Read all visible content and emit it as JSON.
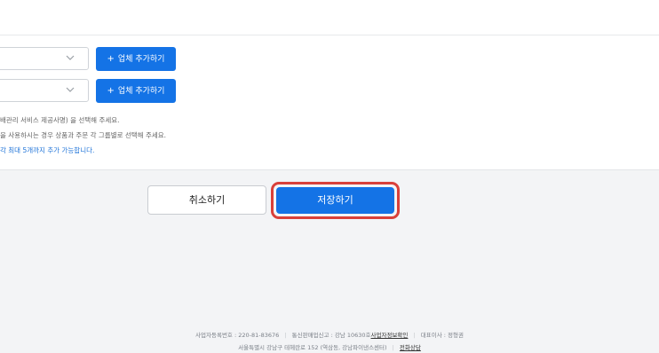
{
  "form": {
    "rows": [
      {
        "select_value": "",
        "add_label": "업체 추가하기"
      },
      {
        "select_value": "",
        "add_label": "업체 추가하기"
      }
    ],
    "notes": [
      "배관리 서비스 제공사명) 을 선택해 주세요.",
      "을 사용하시는 경우 상품과 주문 각 그룹별로 선택해 주세요.",
      "각 최대 5개까지 추가 가능합니다."
    ]
  },
  "actions": {
    "cancel_label": "취소하기",
    "save_label": "저장하기"
  },
  "footer": {
    "business_no": "사업자등록번호 : 220-81-83676",
    "mail_order_prefix": "통신판매업신고 : 강남 10630호",
    "business_info_link": "사업자정보확인",
    "ceo": "대표이사 : 정형권",
    "address": "서울특별시 강남구 테헤란로 152 (역삼동, 강남파이낸스센터)",
    "phone_link": "전화상담"
  },
  "colors": {
    "primary": "#1473e6",
    "highlight_border": "#d9403a",
    "note_highlight": "#1e73d8"
  },
  "icons": {
    "plus": "plus-icon",
    "chevron": "chevron-down-icon"
  }
}
